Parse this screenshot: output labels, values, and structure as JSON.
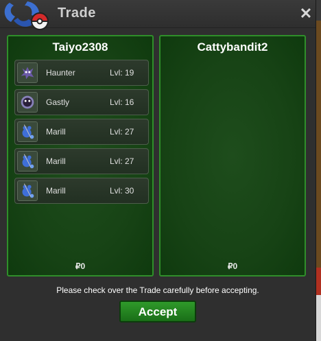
{
  "window": {
    "title": "Trade",
    "close_icon": "close-icon",
    "logo_icon": "pokeball-logo-icon"
  },
  "left_panel": {
    "player_name": "Taiyo2308",
    "currency": "₽0",
    "pokemon": [
      {
        "name": "Haunter",
        "level": "Lvl: 19",
        "icon": "haunter-sprite-icon"
      },
      {
        "name": "Gastly",
        "level": "Lvl: 16",
        "icon": "gastly-sprite-icon"
      },
      {
        "name": "Marill",
        "level": "Lvl: 27",
        "icon": "marill-sprite-icon"
      },
      {
        "name": "Marill",
        "level": "Lvl: 27",
        "icon": "marill-sprite-icon"
      },
      {
        "name": "Marill",
        "level": "Lvl: 30",
        "icon": "marill-sprite-icon"
      }
    ]
  },
  "right_panel": {
    "player_name": "Cattybandit2",
    "currency": "₽0",
    "pokemon": []
  },
  "footer": {
    "notice": "Please check over the Trade carefully before accepting.",
    "accept_label": "Accept"
  },
  "colors": {
    "panel_green": "#174315",
    "panel_border": "#2f8f2a",
    "accept_green": "#2f9a2a"
  }
}
